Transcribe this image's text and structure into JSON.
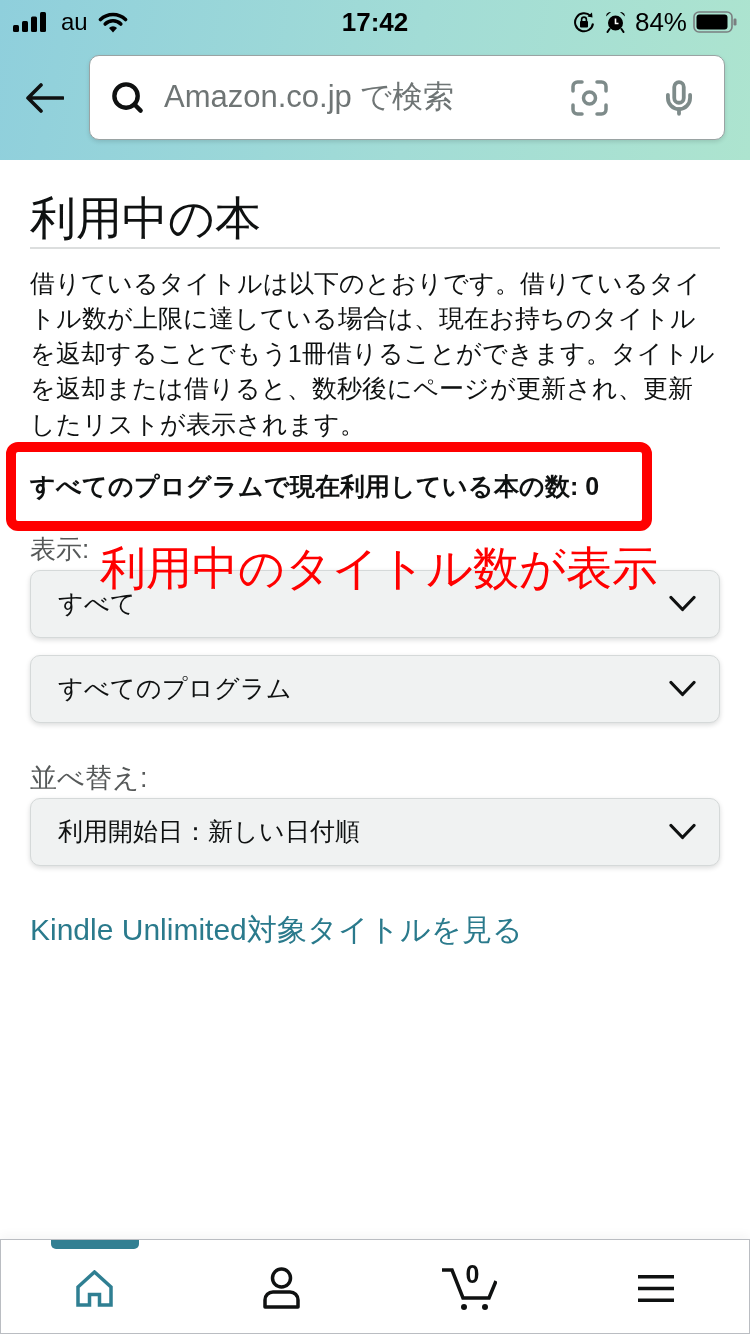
{
  "status_bar": {
    "carrier": "au",
    "time": "17:42",
    "battery": "84%"
  },
  "search": {
    "placeholder": "Amazon.co.jp で検索"
  },
  "page": {
    "title": "利用中の本",
    "description": "借りているタイトルは以下のとおりです。借りているタイトル数が上限に達している場合は、現在お持ちのタイトルを返却することでもう1冊借りることができます。タイトルを返却または借りると、数秒後にページが更新され、更新したリストが表示されます。",
    "count_summary": {
      "text": "すべてのプログラムで現在利用している本の数: 0",
      "highlighted": true
    }
  },
  "filters": {
    "label": "表示:",
    "dropdowns": [
      {
        "value": "すべて"
      },
      {
        "value": "すべてのプログラム"
      }
    ]
  },
  "annotation": {
    "text": "利用中のタイトル数が表示"
  },
  "sort": {
    "label": "並べ替え:",
    "dropdowns": [
      {
        "value": "利用開始日：新しい日付順"
      }
    ]
  },
  "link": {
    "text": "Kindle Unlimited対象タイトルを見る"
  },
  "bottom_nav": [
    {
      "kind": "home",
      "selected": true
    },
    {
      "kind": "account",
      "selected": false
    },
    {
      "kind": "cart",
      "selected": false,
      "count": "0"
    },
    {
      "kind": "menu",
      "selected": false
    }
  ]
}
